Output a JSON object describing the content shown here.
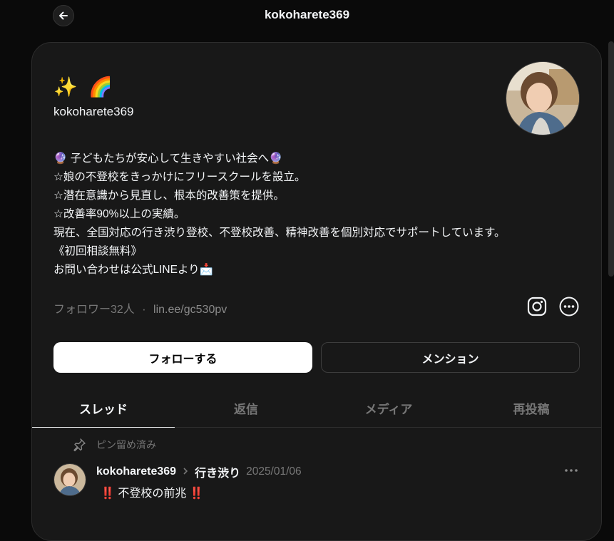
{
  "header": {
    "title": "kokoharete369"
  },
  "profile": {
    "emojis": "✨ 🌈",
    "username": "kokoharete369",
    "bio": [
      "🔮 子どもたちが安心して生きやすい社会へ🔮",
      "☆娘の不登校をきっかけにフリースクールを設立。",
      "☆潜在意識から見直し、根本的改善策を提供。",
      "☆改善率90%以上の実績。",
      "現在、全国対応の行き渋り登校、不登校改善、精神改善を個別対応でサポートしています。",
      "《初回相談無料》",
      "お問い合わせは公式LINEより📩"
    ],
    "followers": "フォロワー32人",
    "dot": "·",
    "link": "lin.ee/gc530pv",
    "icons": {
      "instagram": "instagram-icon",
      "more": "more-options-icon"
    }
  },
  "actions": {
    "follow": "フォローする",
    "mention": "メンション"
  },
  "tabs": [
    "スレッド",
    "返信",
    "メディア",
    "再投稿"
  ],
  "post": {
    "pinned": "ピン留め済み",
    "author": "kokoharete369",
    "topic": "行き渋り",
    "date": "2025/01/06",
    "bang": "‼️",
    "text": "不登校の前兆"
  },
  "colors": {
    "background": "#0a0a0a",
    "card": "#181818",
    "text": "#f3f5f7",
    "muted": "#777777",
    "accent": "#f0305a"
  }
}
